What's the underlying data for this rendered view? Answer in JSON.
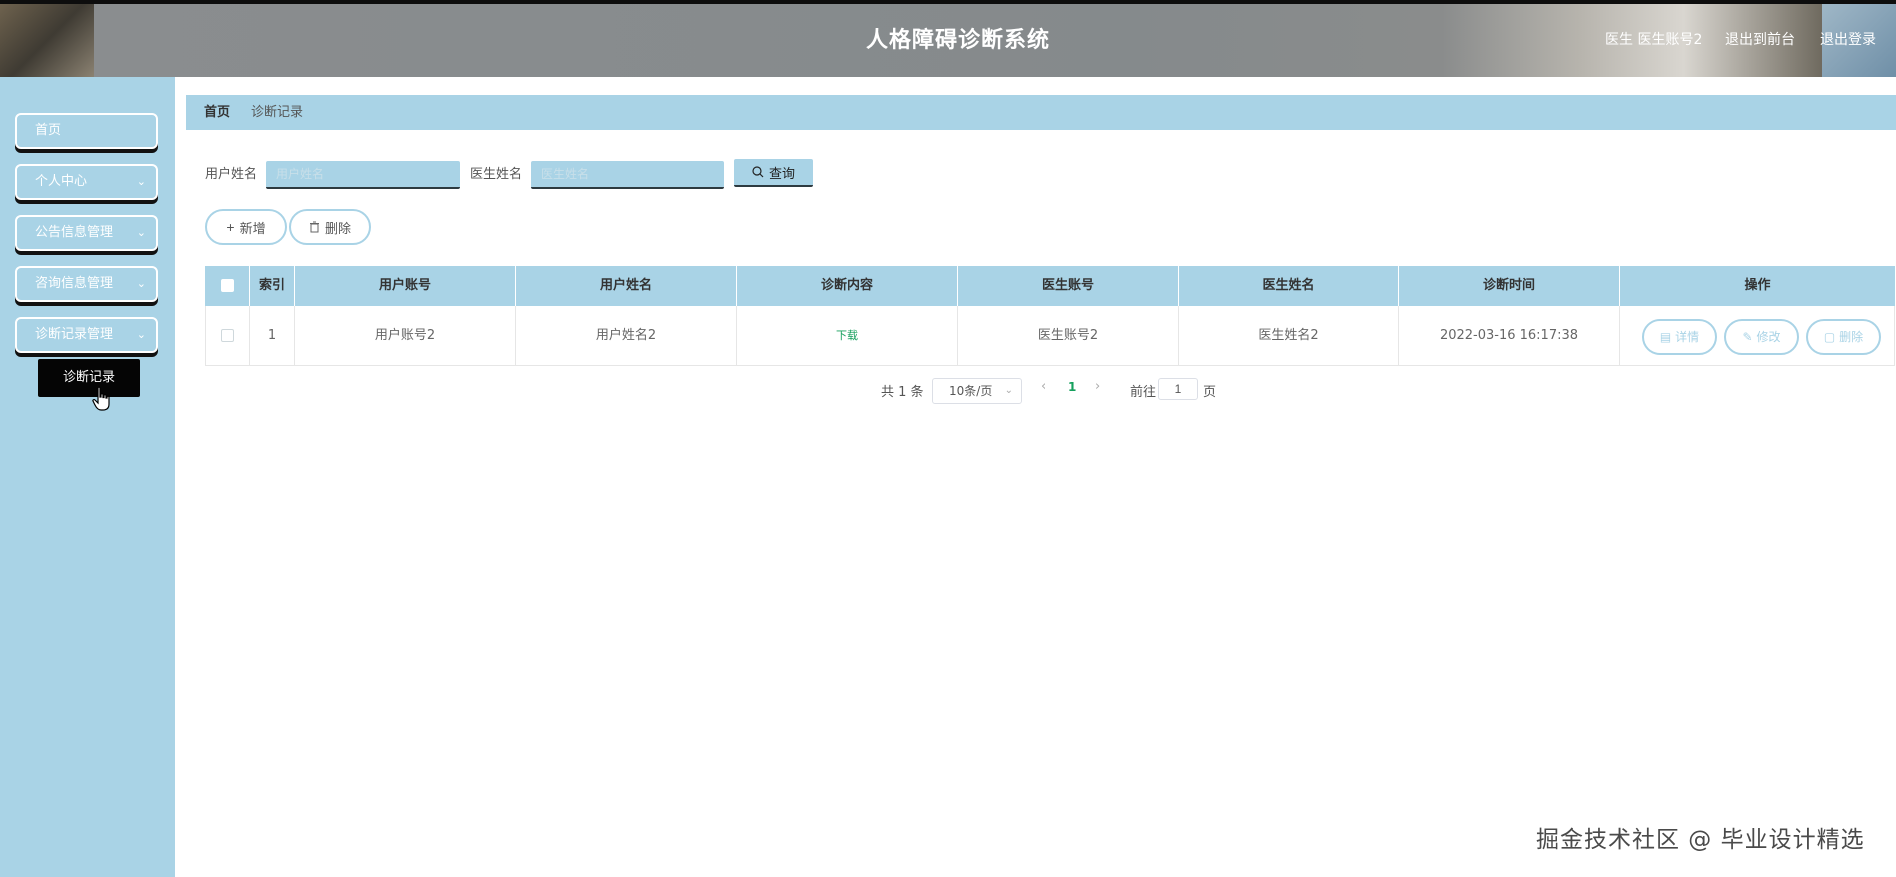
{
  "header": {
    "title": "人格障碍诊断系统",
    "role_user": "医生 医生账号2",
    "back_to_front": "退出到前台",
    "logout": "退出登录"
  },
  "sidebar": {
    "items": [
      {
        "label": "首页",
        "has_chevron": false
      },
      {
        "label": "个人中心",
        "has_chevron": true
      },
      {
        "label": "公告信息管理",
        "has_chevron": true
      },
      {
        "label": "咨询信息管理",
        "has_chevron": true
      },
      {
        "label": "诊断记录管理",
        "has_chevron": true
      }
    ],
    "submenu_item": "诊断记录"
  },
  "breadcrumb": {
    "home": "首页",
    "current": "诊断记录"
  },
  "search": {
    "user_name_label": "用户姓名",
    "user_name_placeholder": "用户姓名",
    "doctor_name_label": "医生姓名",
    "doctor_name_placeholder": "医生姓名",
    "query_button": "查询"
  },
  "actions": {
    "add": "新增",
    "delete": "删除"
  },
  "table": {
    "columns": [
      "索引",
      "用户账号",
      "用户姓名",
      "诊断内容",
      "医生账号",
      "医生姓名",
      "诊断时间",
      "操作"
    ],
    "rows": [
      {
        "index": "1",
        "user_account": "用户账号2",
        "user_name": "用户姓名2",
        "content": "下载",
        "doctor_account": "医生账号2",
        "doctor_name": "医生姓名2",
        "time": "2022-03-16 16:17:38",
        "ops": {
          "detail": "详情",
          "edit": "修改",
          "delete": "删除"
        }
      }
    ]
  },
  "pagination": {
    "total": "共 1 条",
    "page_size": "10条/页",
    "current_page": "1",
    "goto_label": "前往",
    "goto_value": "1",
    "page_suffix": "页"
  },
  "watermark": "掘金技术社区 @ 毕业设计精选",
  "colors": {
    "accent": "#a9d3e6",
    "download_link": "#16a05d"
  }
}
